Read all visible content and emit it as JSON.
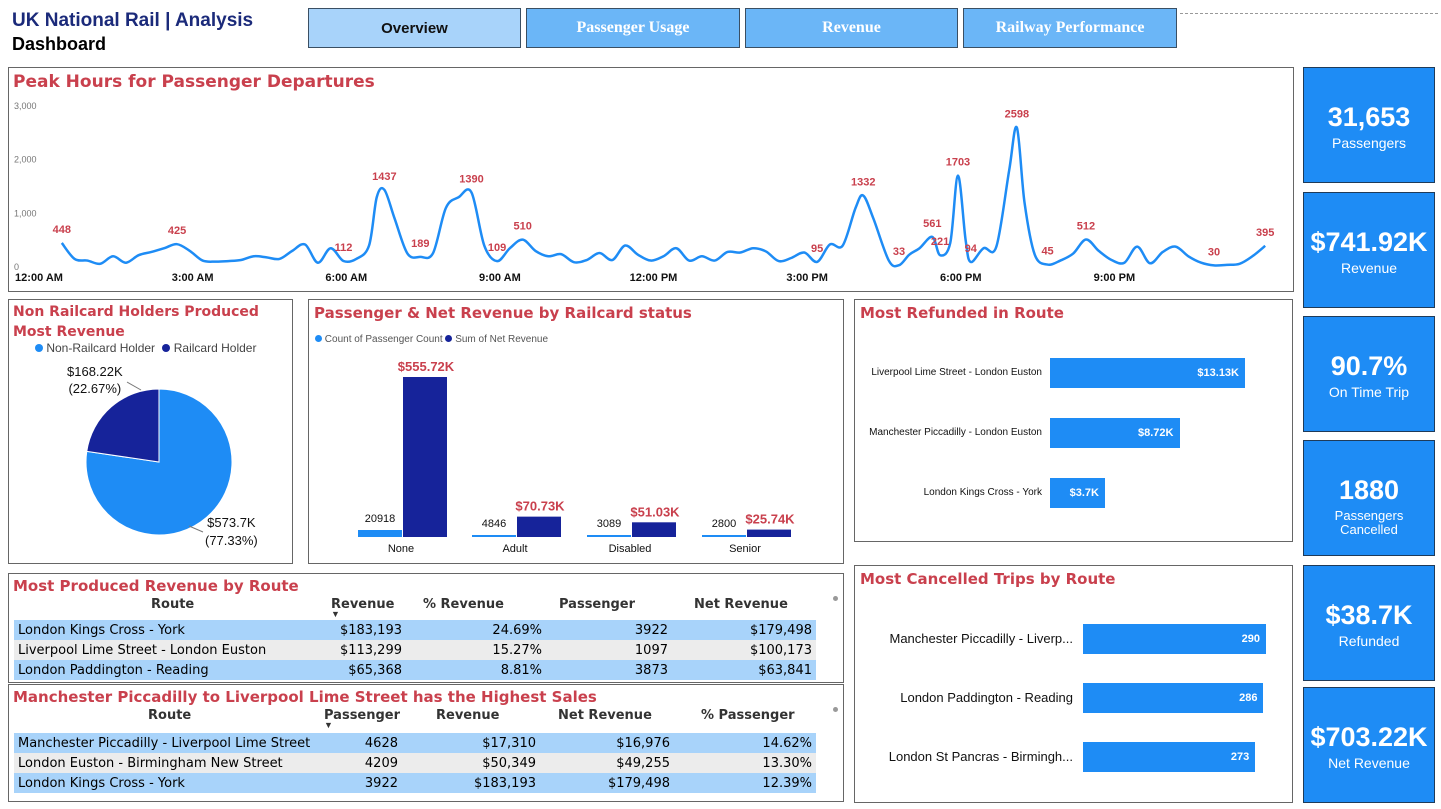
{
  "header": {
    "title_line1": "UK National Rail | Analysis",
    "title_line2": "Dashboard"
  },
  "nav": [
    {
      "label": "Overview",
      "active": true
    },
    {
      "label": "Passenger Usage",
      "active": false
    },
    {
      "label": "Revenue",
      "active": false
    },
    {
      "label": "Railway Performance",
      "active": false
    }
  ],
  "kpis": [
    {
      "value": "31,653",
      "label": "Passengers"
    },
    {
      "value": "$741.92K",
      "label": "Revenue"
    },
    {
      "value": "90.7%",
      "label": "On Time Trip"
    },
    {
      "value": "1880",
      "label": "Passengers Cancelled"
    },
    {
      "value": "$38.7K",
      "label": "Refunded"
    },
    {
      "value": "$703.22K",
      "label": "Net Revenue"
    }
  ],
  "peak_chart": {
    "title": "Peak Hours for Passenger Departures",
    "y_ticks": [
      "3,000",
      "2,000",
      "1,000",
      "0"
    ],
    "x_ticks": [
      "12:00 AM",
      "3:00 AM",
      "6:00 AM",
      "9:00 AM",
      "12:00 PM",
      "3:00 PM",
      "6:00 PM",
      "9:00 PM"
    ]
  },
  "pie_panel": {
    "title": "Non Railcard Holders Produced Most Revenue",
    "legend": [
      "Non-Railcard Holder",
      "Railcard Holder"
    ],
    "label_small_value": "$168.22K",
    "label_small_pct": "(22.67%)",
    "label_big_value": "$573.7K",
    "label_big_pct": "(77.33%)"
  },
  "railcard_panel": {
    "title": "Passenger & Net Revenue by Railcard status",
    "legend": [
      "Count of Passenger Count",
      "Sum of Net Revenue"
    ]
  },
  "refund_panel": {
    "title": "Most Refunded in Route",
    "rows": [
      {
        "route": "Liverpool Lime Street - London Euston",
        "value": "$13.13K"
      },
      {
        "route": "Manchester Piccadilly - London Euston",
        "value": "$8.72K"
      },
      {
        "route": "London Kings Cross - York",
        "value": "$3.7K"
      }
    ]
  },
  "cancel_panel": {
    "title": "Most Cancelled Trips by Route",
    "rows": [
      {
        "route": "Manchester Piccadilly - Liverp...",
        "value": "290"
      },
      {
        "route": "London Paddington - Reading",
        "value": "286"
      },
      {
        "route": "London St Pancras - Birmingh...",
        "value": "273"
      }
    ]
  },
  "revenue_table": {
    "title": "Most Produced Revenue by Route",
    "headers": [
      "Route",
      "Revenue",
      "% Revenue",
      "Passenger",
      "Net Revenue"
    ],
    "rows": [
      [
        "London Kings Cross - York",
        "$183,193",
        "24.69%",
        "3922",
        "$179,498"
      ],
      [
        "Liverpool Lime Street - London Euston",
        "$113,299",
        "15.27%",
        "1097",
        "$100,173"
      ],
      [
        "London Paddington - Reading",
        "$65,368",
        "8.81%",
        "3873",
        "$63,841"
      ]
    ]
  },
  "sales_table": {
    "title": "Manchester Piccadilly to Liverpool Lime Street has the Highest Sales",
    "headers": [
      "Route",
      "Passenger",
      "Revenue",
      "Net Revenue",
      "% Passenger"
    ],
    "rows": [
      [
        "Manchester Piccadilly - Liverpool Lime Street",
        "4628",
        "$17,310",
        "$16,976",
        "14.62%"
      ],
      [
        "London Euston - Birmingham New Street",
        "4209",
        "$50,349",
        "$49,255",
        "13.30%"
      ],
      [
        "London Kings Cross - York",
        "3922",
        "$183,193",
        "$179,498",
        "12.39%"
      ]
    ]
  },
  "colors": {
    "accent": "#1e8cf5",
    "dark_blue": "#16239a",
    "title_red": "#c9404d",
    "nav_blue": "#6bb6f7"
  },
  "chart_data": [
    {
      "type": "line",
      "title": "Peak Hours for Passenger Departures",
      "ylim": [
        0,
        3000
      ],
      "x_ticks": [
        "12:00 AM",
        "3:00 AM",
        "6:00 AM",
        "9:00 AM",
        "12:00 PM",
        "3:00 PM",
        "6:00 PM",
        "9:00 PM"
      ],
      "x_range_hours": [
        0,
        24
      ],
      "series": [
        {
          "points": [
            [
              0.25,
              448
            ],
            [
              0.5,
              150
            ],
            [
              0.75,
              120
            ],
            [
              1.0,
              60
            ],
            [
              1.25,
              200
            ],
            [
              1.5,
              80
            ],
            [
              1.75,
              220
            ],
            [
              2.0,
              280
            ],
            [
              2.25,
              350
            ],
            [
              2.5,
              425
            ],
            [
              2.75,
              300
            ],
            [
              3.0,
              120
            ],
            [
              3.25,
              100
            ],
            [
              3.5,
              110
            ],
            [
              3.75,
              130
            ],
            [
              4.0,
              200
            ],
            [
              4.25,
              180
            ],
            [
              4.5,
              150
            ],
            [
              4.75,
              300
            ],
            [
              5.0,
              420
            ],
            [
              5.25,
              80
            ],
            [
              5.5,
              350
            ],
            [
              5.75,
              112
            ],
            [
              6.0,
              150
            ],
            [
              6.25,
              400
            ],
            [
              6.4,
              1300
            ],
            [
              6.55,
              1437
            ],
            [
              6.75,
              900
            ],
            [
              7.0,
              250
            ],
            [
              7.25,
              189
            ],
            [
              7.5,
              260
            ],
            [
              7.75,
              1100
            ],
            [
              8.0,
              1300
            ],
            [
              8.25,
              1390
            ],
            [
              8.5,
              400
            ],
            [
              8.75,
              109
            ],
            [
              9.0,
              350
            ],
            [
              9.25,
              510
            ],
            [
              9.5,
              300
            ],
            [
              9.75,
              200
            ],
            [
              10.0,
              240
            ],
            [
              10.25,
              90
            ],
            [
              10.5,
              130
            ],
            [
              10.75,
              260
            ],
            [
              11.0,
              130
            ],
            [
              11.25,
              400
            ],
            [
              11.5,
              230
            ],
            [
              11.75,
              120
            ],
            [
              12.0,
              200
            ],
            [
              12.25,
              350
            ],
            [
              12.5,
              120
            ],
            [
              12.75,
              200
            ],
            [
              13.0,
              120
            ],
            [
              13.25,
              280
            ],
            [
              13.5,
              270
            ],
            [
              13.75,
              350
            ],
            [
              14.0,
              290
            ],
            [
              14.25,
              110
            ],
            [
              14.5,
              170
            ],
            [
              14.75,
              270
            ],
            [
              15.0,
              95
            ],
            [
              15.25,
              420
            ],
            [
              15.5,
              400
            ],
            [
              15.75,
              1100
            ],
            [
              15.9,
              1332
            ],
            [
              16.1,
              900
            ],
            [
              16.4,
              120
            ],
            [
              16.6,
              33
            ],
            [
              16.8,
              230
            ],
            [
              17.0,
              350
            ],
            [
              17.25,
              561
            ],
            [
              17.4,
              221
            ],
            [
              17.6,
              450
            ],
            [
              17.75,
              1703
            ],
            [
              17.9,
              500
            ],
            [
              18.0,
              94
            ],
            [
              18.25,
              350
            ],
            [
              18.5,
              380
            ],
            [
              18.75,
              1800
            ],
            [
              18.9,
              2598
            ],
            [
              19.05,
              1200
            ],
            [
              19.25,
              230
            ],
            [
              19.5,
              45
            ],
            [
              19.75,
              120
            ],
            [
              20.0,
              250
            ],
            [
              20.25,
              512
            ],
            [
              20.5,
              300
            ],
            [
              20.75,
              130
            ],
            [
              21.0,
              80
            ],
            [
              21.25,
              380
            ],
            [
              21.5,
              70
            ],
            [
              21.75,
              280
            ],
            [
              22.0,
              380
            ],
            [
              22.25,
              200
            ],
            [
              22.5,
              80
            ],
            [
              22.75,
              30
            ],
            [
              23.0,
              40
            ],
            [
              23.25,
              60
            ],
            [
              23.5,
              200
            ],
            [
              23.75,
              395
            ]
          ]
        }
      ],
      "data_labels": [
        {
          "x": 0.25,
          "y": 448,
          "text": "448"
        },
        {
          "x": 2.5,
          "y": 425,
          "text": "425"
        },
        {
          "x": 5.75,
          "y": 112,
          "text": "112"
        },
        {
          "x": 6.55,
          "y": 1437,
          "text": "1437"
        },
        {
          "x": 7.25,
          "y": 189,
          "text": "189"
        },
        {
          "x": 8.25,
          "y": 1390,
          "text": "1390"
        },
        {
          "x": 8.75,
          "y": 109,
          "text": "109"
        },
        {
          "x": 9.25,
          "y": 510,
          "text": "510"
        },
        {
          "x": 15.0,
          "y": 95,
          "text": "95"
        },
        {
          "x": 15.9,
          "y": 1332,
          "text": "1332"
        },
        {
          "x": 16.6,
          "y": 33,
          "text": "33"
        },
        {
          "x": 17.25,
          "y": 561,
          "text": "561"
        },
        {
          "x": 17.4,
          "y": 221,
          "text": "221"
        },
        {
          "x": 17.75,
          "y": 1703,
          "text": "1703"
        },
        {
          "x": 18.0,
          "y": 94,
          "text": "94"
        },
        {
          "x": 18.9,
          "y": 2598,
          "text": "2598"
        },
        {
          "x": 19.5,
          "y": 45,
          "text": "45"
        },
        {
          "x": 20.25,
          "y": 512,
          "text": "512"
        },
        {
          "x": 22.75,
          "y": 30,
          "text": "30"
        },
        {
          "x": 23.75,
          "y": 395,
          "text": "395"
        }
      ]
    },
    {
      "type": "pie",
      "title": "Non Railcard Holders Produced Most Revenue",
      "categories": [
        "Non-Railcard Holder",
        "Railcard Holder"
      ],
      "values": [
        573.7,
        168.22
      ],
      "percents": [
        77.33,
        22.67
      ],
      "colors": [
        "#1e8cf5",
        "#16239a"
      ]
    },
    {
      "type": "bar",
      "title": "Passenger & Net Revenue by Railcard status",
      "categories": [
        "None",
        "Adult",
        "Disabled",
        "Senior"
      ],
      "series": [
        {
          "name": "Count of Passenger Count",
          "values": [
            20918,
            4846,
            3089,
            2800
          ],
          "labels": [
            "20918",
            "4846",
            "3089",
            "2800"
          ],
          "color": "#1e8cf5"
        },
        {
          "name": "Sum of Net Revenue",
          "values": [
            555.72,
            70.73,
            51.03,
            25.74
          ],
          "labels": [
            "$555.72K",
            "$70.73K",
            "$51.03K",
            "$25.74K"
          ],
          "color": "#16239a"
        }
      ]
    },
    {
      "type": "bar",
      "title": "Most Refunded in Route",
      "categories": [
        "Liverpool Lime Street - London Euston",
        "Manchester Piccadilly - London Euston",
        "London Kings Cross - York"
      ],
      "values": [
        13.13,
        8.72,
        3.7
      ],
      "labels": [
        "$13.13K",
        "$8.72K",
        "$3.7K"
      ]
    },
    {
      "type": "bar",
      "title": "Most Cancelled Trips by Route",
      "categories": [
        "Manchester Piccadilly - Liverp...",
        "London Paddington - Reading",
        "London St Pancras - Birmingh..."
      ],
      "values": [
        290,
        286,
        273
      ],
      "labels": [
        "290",
        "286",
        "273"
      ]
    }
  ]
}
